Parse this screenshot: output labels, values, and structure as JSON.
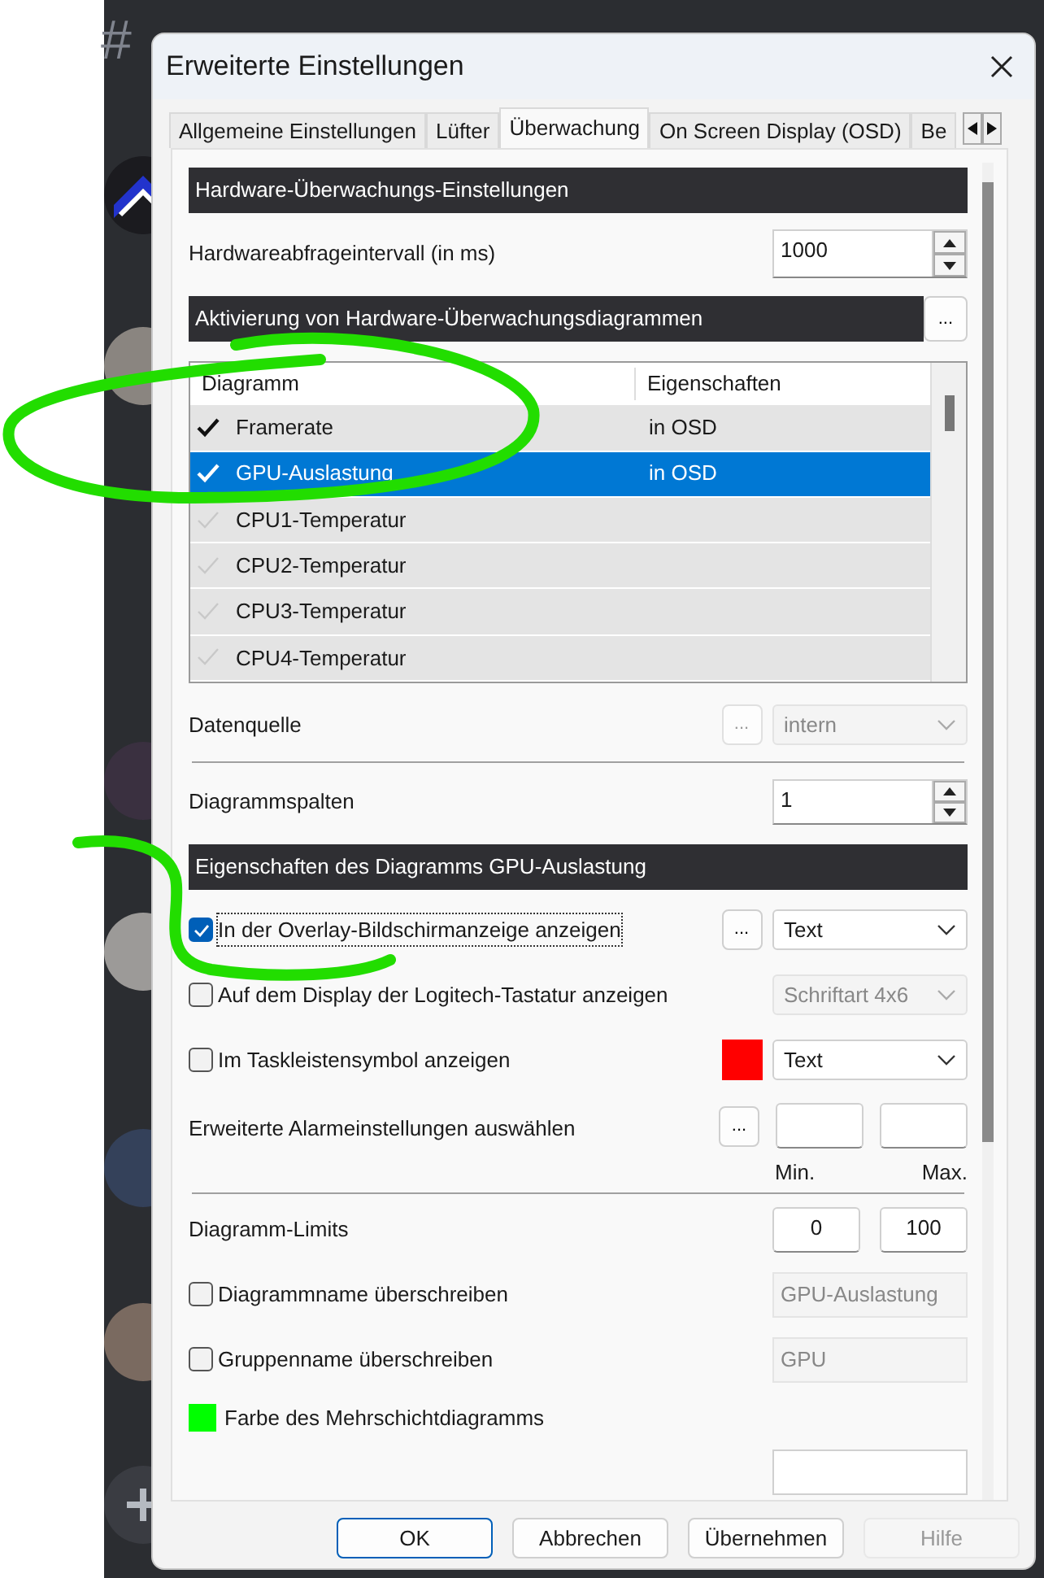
{
  "sidebar": {
    "channel_glyph": "#"
  },
  "window": {
    "title": "Erweiterte Einstellungen"
  },
  "tabs": [
    {
      "label": "Allgemeine Einstellungen",
      "selected": false
    },
    {
      "label": "Lüfter",
      "selected": false
    },
    {
      "label": "Überwachung",
      "selected": true
    },
    {
      "label": "On Screen Display (OSD)",
      "selected": false
    },
    {
      "label": "Be",
      "selected": false
    }
  ],
  "hardware": {
    "header": "Hardware-Überwachungs-Einstellungen",
    "label": "Hardwareabfrageintervall (in ms)",
    "value": "1000"
  },
  "graphs": {
    "header": "Aktivierung von Hardware-Überwachungsdiagrammen",
    "button": "...",
    "columns": [
      "Diagramm",
      "Eigenschaften"
    ],
    "rows": [
      {
        "name": "Framerate",
        "properties": "in OSD",
        "enabled": true,
        "selected": false
      },
      {
        "name": "GPU-Auslastung",
        "properties": "in OSD",
        "enabled": true,
        "selected": true
      },
      {
        "name": "CPU1-Temperatur",
        "enabled": false,
        "selected": false
      },
      {
        "name": "CPU2-Temperatur",
        "enabled": false,
        "selected": false
      },
      {
        "name": "CPU3-Temperatur",
        "enabled": false,
        "selected": false
      },
      {
        "name": "CPU4-Temperatur",
        "enabled": false,
        "selected": false
      }
    ]
  },
  "data_source": {
    "label": "Datenquelle",
    "button": "...",
    "value": "intern",
    "disabled": true
  },
  "graph_columns": {
    "label": "Diagrammspalten",
    "value": "1"
  },
  "properties": {
    "header": "Eigenschaften des Diagramms GPU-Auslastung",
    "rows": [
      {
        "kind": "option",
        "label": "In der Overlay-Bildschirmanzeige anzeigen",
        "checked": true,
        "focused": true,
        "button": "...",
        "select": "Text",
        "select_disabled": false
      },
      {
        "kind": "option",
        "label": "Auf dem Display der Logitech-Tastatur anzeigen",
        "checked": false,
        "select": "Schriftart 4x6",
        "select_disabled": true
      },
      {
        "kind": "option",
        "label": "Im Taskleistensymbol anzeigen",
        "checked": false,
        "color": "#ff0000",
        "select": "Text",
        "select_disabled": false
      },
      {
        "kind": "alarm",
        "label": "Erweiterte Alarmeinstellungen auswählen",
        "button": "...",
        "min_label": "Min.",
        "max_label": "Max."
      },
      {
        "kind": "limits",
        "label": "Diagramm-Limits",
        "min": "0",
        "max": "100"
      },
      {
        "kind": "override",
        "label": "Diagrammname überschreiben",
        "checked": false,
        "value": "GPU-Auslastung",
        "disabled": true
      },
      {
        "kind": "override",
        "label": "Gruppenname überschreiben",
        "checked": false,
        "value": "GPU",
        "disabled": true
      },
      {
        "kind": "color",
        "label": "Farbe des Mehrschichtdiagramms",
        "color": "#00ff00"
      },
      {
        "kind": "cutoff"
      }
    ]
  },
  "buttons": [
    {
      "label": "OK",
      "default": true,
      "disabled": false
    },
    {
      "label": "Abbrechen",
      "default": false,
      "disabled": false
    },
    {
      "label": "Übernehmen",
      "default": false,
      "disabled": false
    },
    {
      "label": "Hilfe",
      "default": false,
      "disabled": true
    }
  ]
}
